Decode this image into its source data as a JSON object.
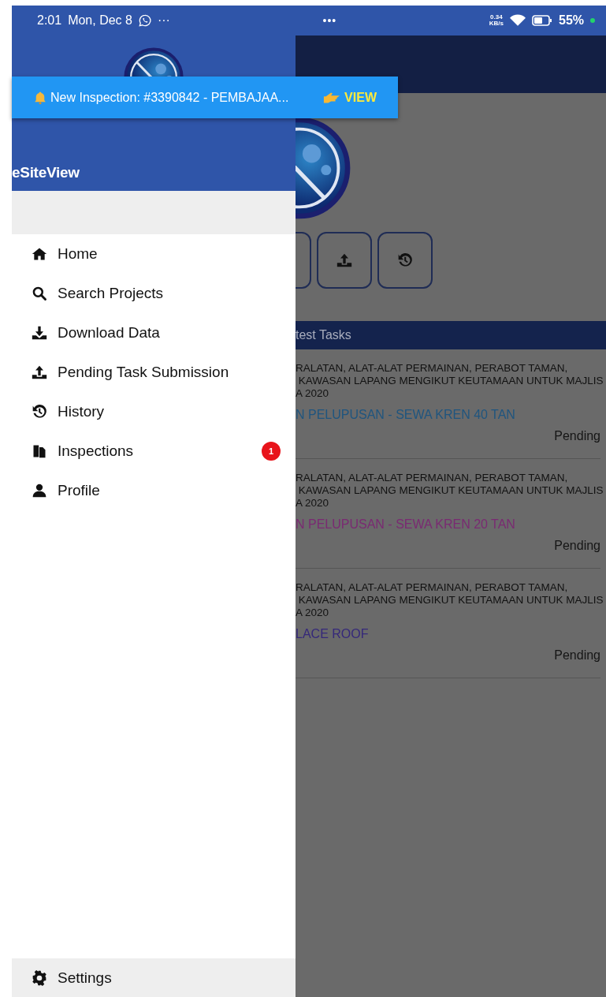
{
  "status_bar": {
    "time": "2:01",
    "date": "Mon, Dec 8",
    "more": "···",
    "center": "•••",
    "speed_value": "0.34",
    "speed_unit": "KB/s",
    "battery": "55%"
  },
  "notification": {
    "message": "New Inspection: #3390842 - PEMBAJAA...",
    "action": "VIEW"
  },
  "drawer": {
    "title": "eSiteView",
    "items": [
      {
        "label": "Home"
      },
      {
        "label": "Search Projects"
      },
      {
        "label": "Download Data"
      },
      {
        "label": "Pending Task Submission"
      },
      {
        "label": "History"
      },
      {
        "label": "Inspections",
        "badge": "1"
      },
      {
        "label": "Profile"
      }
    ],
    "footer_item": {
      "label": "Settings"
    }
  },
  "background_app": {
    "section_title": "test Tasks",
    "tasks": [
      {
        "description_lines": [
          "RALATAN, ALAT-ALAT PERMAINAN, PERABOT TAMAN,",
          " KAWASAN LAPANG MENGIKUT KEUTAMAAN UNTUK MAJLIS",
          "A 2020"
        ],
        "title": "N PELUPUSAN - SEWA KREN 40 TAN",
        "color": "#1f557f",
        "status": "Pending"
      },
      {
        "description_lines": [
          "RALATAN, ALAT-ALAT PERMAINAN, PERABOT TAMAN,",
          " KAWASAN LAPANG MENGIKUT KEUTAMAAN UNTUK MAJLIS",
          "A 2020"
        ],
        "title": "N PELUPUSAN - SEWA KREN 20 TAN",
        "color": "#7a2a72",
        "status": "Pending"
      },
      {
        "description_lines": [
          "RALATAN, ALAT-ALAT PERMAINAN, PERABOT TAMAN,",
          " KAWASAN LAPANG MENGIKUT KEUTAMAAN UNTUK MAJLIS",
          "A 2020"
        ],
        "title": "LACE ROOF",
        "color": "#35287a",
        "status": "Pending"
      }
    ]
  }
}
